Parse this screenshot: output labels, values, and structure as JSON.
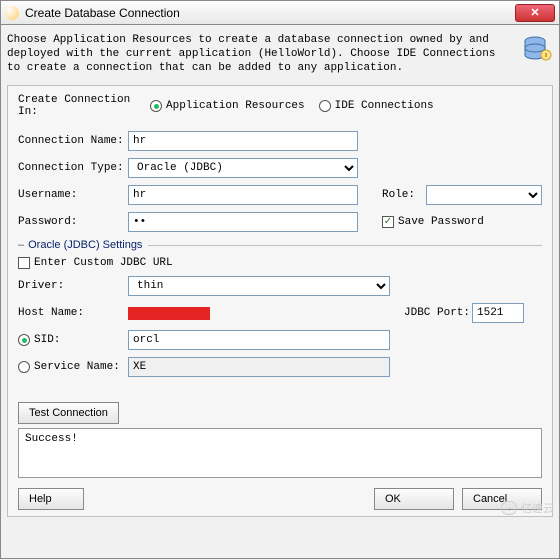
{
  "window": {
    "title": "Create Database Connection",
    "close": "✕"
  },
  "description": "Choose Application Resources to create a database connection owned by and deployed with the current application (HelloWorld). Choose IDE Connections to create a connection that can be added to any application.",
  "createIn": {
    "label": "Create Connection In:",
    "opt1": "Application Resources",
    "opt2": "IDE Connections"
  },
  "connName": {
    "label": "Connection Name:",
    "value": "hr"
  },
  "connType": {
    "label": "Connection Type:",
    "value": "Oracle (JDBC)"
  },
  "username": {
    "label": "Username:",
    "value": "hr"
  },
  "password": {
    "label": "Password:",
    "value": "••"
  },
  "role": {
    "label": "Role:",
    "value": ""
  },
  "savePwd": {
    "label": "Save Password"
  },
  "jdbcSection": "Oracle (JDBC) Settings",
  "customUrl": {
    "label": "Enter Custom JDBC URL"
  },
  "driver": {
    "label": "Driver:",
    "value": "thin"
  },
  "hostName": {
    "label": "Host Name:"
  },
  "jdbcPort": {
    "label": "JDBC Port:",
    "value": "1521"
  },
  "sid": {
    "label": "SID:",
    "value": "orcl"
  },
  "serviceName": {
    "label": "Service Name:",
    "value": "XE"
  },
  "testBtn": "Test Connection",
  "result": "Success!",
  "helpBtn": "Help",
  "okBtn": "OK",
  "cancelBtn": "Cancel",
  "watermark": "亿速云"
}
